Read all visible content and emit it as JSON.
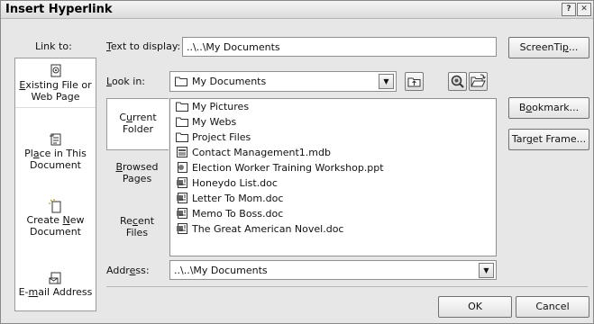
{
  "window": {
    "title": "Insert Hyperlink",
    "help_label": "?",
    "close_label": "✕"
  },
  "link_to": {
    "label": "Link to:",
    "items": [
      {
        "line1": "Existing File or",
        "line2": "Web Page",
        "icon": "existing-file-icon",
        "selected": true
      },
      {
        "line1": "Place in This",
        "line2": "Document",
        "icon": "place-in-document-icon",
        "selected": false
      },
      {
        "line1": "Create New",
        "line2": "Document",
        "icon": "create-new-document-icon",
        "selected": false
      },
      {
        "line1": "E-mail Address",
        "line2": "",
        "icon": "email-address-icon",
        "selected": false
      }
    ]
  },
  "text_to_display": {
    "label": "Text to display:",
    "value": "..\\..\\My Documents"
  },
  "screentip_button": "ScreenTip...",
  "look_in": {
    "label": "Look in:",
    "value": "My Documents"
  },
  "tabs": [
    {
      "line1": "Current",
      "line2": "Folder",
      "selected": true
    },
    {
      "line1": "Browsed",
      "line2": "Pages",
      "selected": false
    },
    {
      "line1": "Recent",
      "line2": "Files",
      "selected": false
    }
  ],
  "files": [
    {
      "name": "My Pictures",
      "icon": "folder-icon"
    },
    {
      "name": "My Webs",
      "icon": "folder-icon"
    },
    {
      "name": "Project Files",
      "icon": "folder-icon"
    },
    {
      "name": "Contact Management1.mdb",
      "icon": "access-database-icon"
    },
    {
      "name": "Election Worker Training Workshop.ppt",
      "icon": "powerpoint-file-icon"
    },
    {
      "name": "Honeydo List.doc",
      "icon": "word-document-icon"
    },
    {
      "name": "Letter To Mom.doc",
      "icon": "word-document-icon"
    },
    {
      "name": "Memo To Boss.doc",
      "icon": "word-document-icon"
    },
    {
      "name": "The Great American Novel.doc",
      "icon": "word-document-icon"
    }
  ],
  "side_buttons": {
    "bookmark": "Bookmark...",
    "target_frame": "Target Frame..."
  },
  "address": {
    "label": "Address:",
    "value": "..\\..\\My Documents"
  },
  "ok_button": "OK",
  "cancel_button": "Cancel"
}
